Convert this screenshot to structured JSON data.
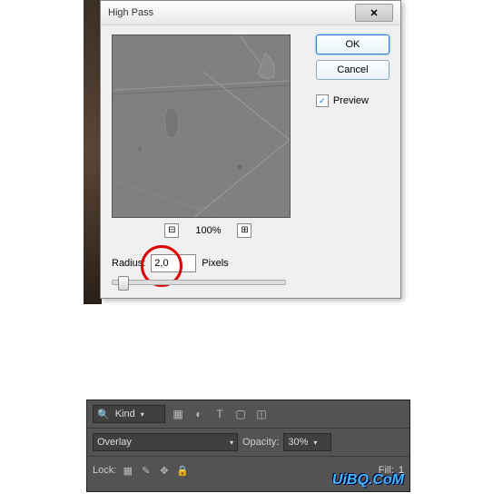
{
  "dialog": {
    "title": "High Pass",
    "ok_label": "OK",
    "cancel_label": "Cancel",
    "preview_label": "Preview",
    "preview_checked": true,
    "zoom_minus": "⊟",
    "zoom_plus": "⊞",
    "zoom_pct": "100%",
    "radius_label": "Radius:",
    "radius_value": "2,0",
    "radius_unit": "Pixels"
  },
  "layers": {
    "kind_icon": "🔍",
    "kind_value": "Kind",
    "filter_icons": [
      "▦",
      "◐",
      "T",
      "▢",
      "◫"
    ],
    "blend_value": "Overlay",
    "opacity_label": "Opacity:",
    "opacity_value": "30%",
    "lock_label": "Lock:",
    "lock_icons": [
      "▦",
      "✎",
      "✥",
      "🔒"
    ],
    "fill_label": "Fill:",
    "fill_value": "1"
  },
  "watermark": "UiBQ.CoM"
}
